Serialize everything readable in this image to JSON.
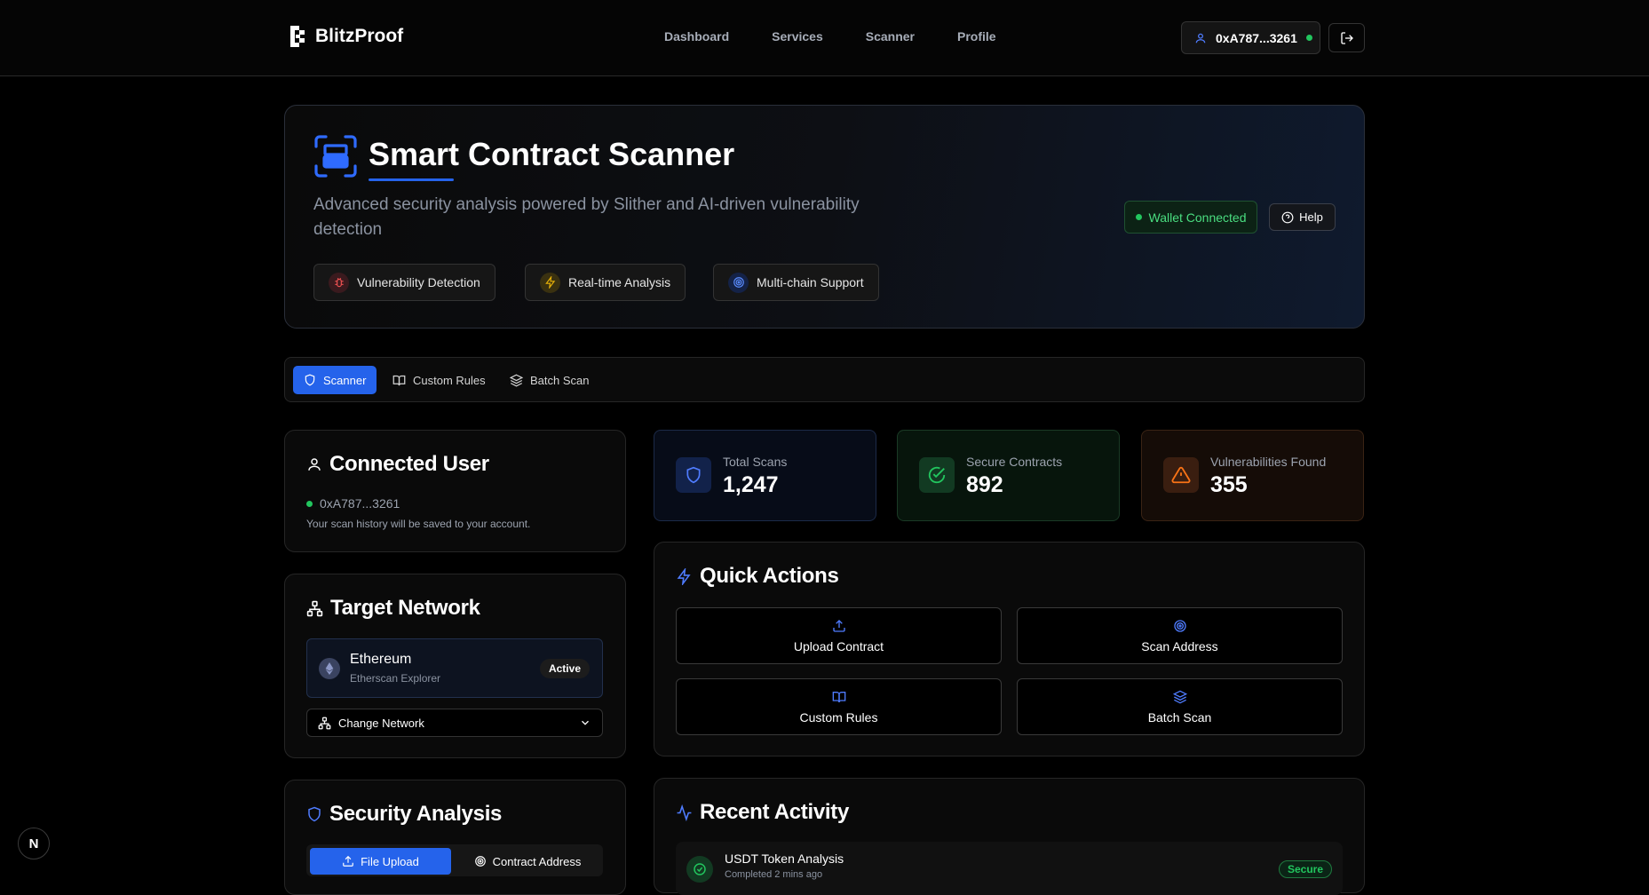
{
  "brand": {
    "name": "BlitzProof"
  },
  "nav": {
    "links": [
      "Dashboard",
      "Services",
      "Scanner",
      "Profile"
    ]
  },
  "wallet": {
    "address": "0xA787...3261"
  },
  "hero": {
    "title": "Smart Contract Scanner",
    "subtitle": "Advanced security analysis powered by Slither and AI-driven vulnerability detection",
    "chips": [
      "Vulnerability Detection",
      "Real-time Analysis",
      "Multi-chain Support"
    ],
    "status": "Wallet Connected",
    "help": "Help"
  },
  "tabs": [
    {
      "label": "Scanner",
      "active": true
    },
    {
      "label": "Custom Rules",
      "active": false
    },
    {
      "label": "Batch Scan",
      "active": false
    }
  ],
  "connected_user": {
    "title": "Connected User",
    "address": "0xA787...3261",
    "note": "Your scan history will be saved to your account."
  },
  "target_network": {
    "title": "Target Network",
    "network": "Ethereum",
    "explorer": "Etherscan Explorer",
    "badge": "Active",
    "change": "Change Network"
  },
  "security_analysis": {
    "title": "Security Analysis",
    "modes": [
      "File Upload",
      "Contract Address"
    ]
  },
  "stats": [
    {
      "label": "Total Scans",
      "value": "1,247"
    },
    {
      "label": "Secure Contracts",
      "value": "892"
    },
    {
      "label": "Vulnerabilities Found",
      "value": "355"
    }
  ],
  "quick_actions": {
    "title": "Quick Actions",
    "items": [
      "Upload Contract",
      "Scan Address",
      "Custom Rules",
      "Batch Scan"
    ]
  },
  "recent_activity": {
    "title": "Recent Activity",
    "items": [
      {
        "name": "USDT Token Analysis",
        "sub": "Completed 2 mins ago",
        "status": "Secure"
      }
    ]
  },
  "colors": {
    "accent": "#2563eb",
    "success": "#22c55e",
    "warning": "#f97316",
    "danger": "#ef4444"
  },
  "dev_badge": "N"
}
